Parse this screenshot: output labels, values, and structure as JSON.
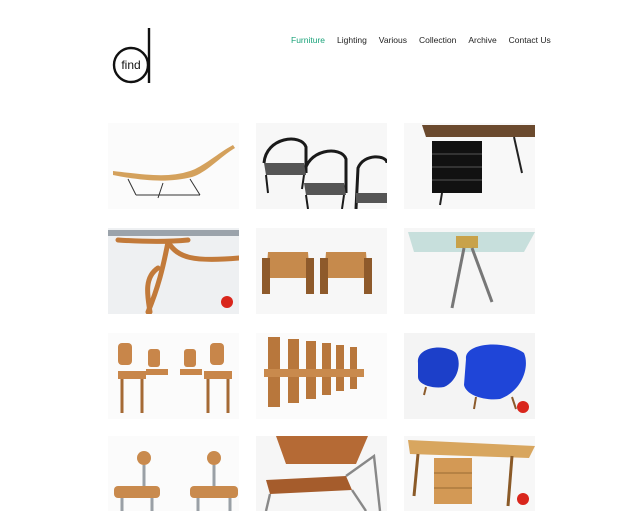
{
  "brand": {
    "logo_text": "find",
    "logo_letter": "d",
    "accent": "#1aa37a",
    "sold_dot_color": "#d9261c"
  },
  "nav": {
    "items": [
      {
        "label": "Furniture",
        "active": true
      },
      {
        "label": "Lighting",
        "active": false
      },
      {
        "label": "Various",
        "active": false
      },
      {
        "label": "Collection",
        "active": false
      },
      {
        "label": "Archive",
        "active": false
      },
      {
        "label": "Contact Us",
        "active": false
      }
    ]
  },
  "products": [
    {
      "id": "chaise-longue",
      "icon": "chaise-longue",
      "sold": false
    },
    {
      "id": "black-armchairs",
      "icon": "armchair-set",
      "sold": false
    },
    {
      "id": "walnut-desk",
      "icon": "desk",
      "sold": false
    },
    {
      "id": "wooden-table-base",
      "icon": "table-base",
      "sold": true
    },
    {
      "id": "leather-spanish-chairs",
      "icon": "lounge-chairs",
      "sold": false
    },
    {
      "id": "glass-table",
      "icon": "glass-table",
      "sold": false
    },
    {
      "id": "four-chairs",
      "icon": "dining-chairs",
      "sold": false
    },
    {
      "id": "six-chairs",
      "icon": "chair-row",
      "sold": false
    },
    {
      "id": "blue-armchairs",
      "icon": "armchairs-blue",
      "sold": true
    },
    {
      "id": "stools",
      "icon": "stools",
      "sold": false
    },
    {
      "id": "leather-chair",
      "icon": "leather-chair",
      "sold": false
    },
    {
      "id": "sculptural-desk",
      "icon": "desk-wood",
      "sold": true
    }
  ]
}
